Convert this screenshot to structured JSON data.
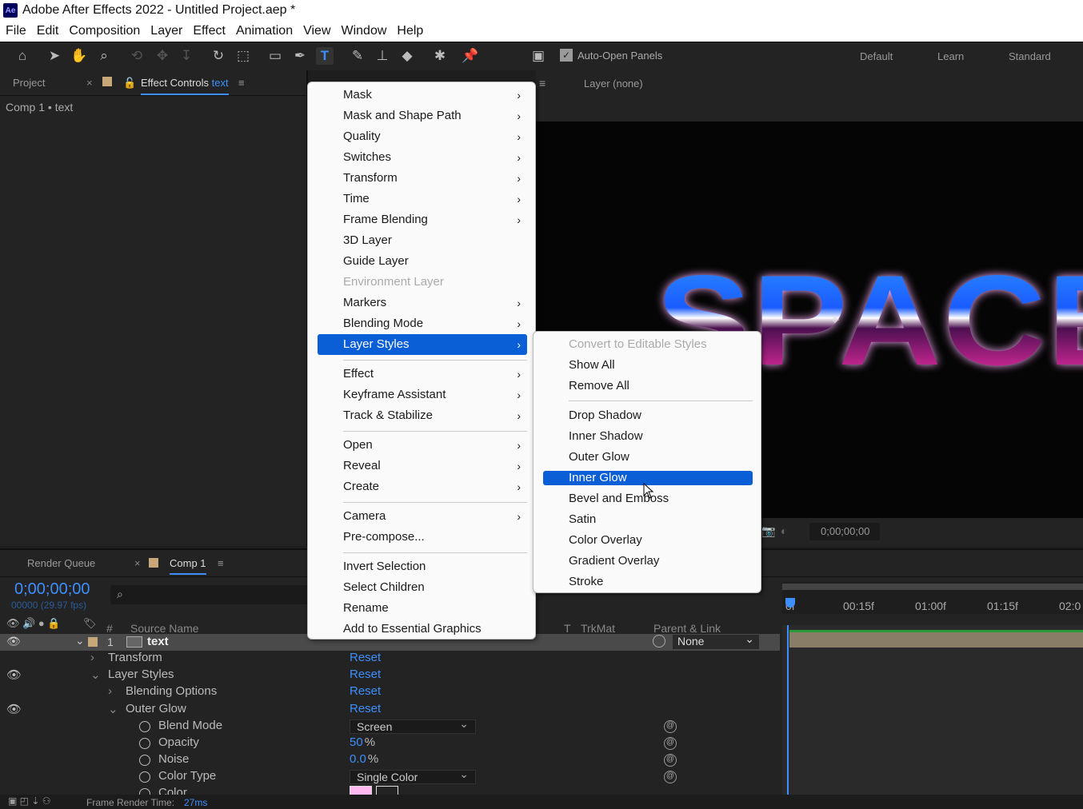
{
  "title": "Adobe After Effects 2022 - Untitled Project.aep *",
  "app_icon": "Ae",
  "menubar": [
    "File",
    "Edit",
    "Composition",
    "Layer",
    "Effect",
    "Animation",
    "View",
    "Window",
    "Help"
  ],
  "toolbar": {
    "auto_open": "Auto-Open Panels",
    "workspaces": [
      "Default",
      "Learn",
      "Standard"
    ]
  },
  "left_panel": {
    "tab_project": "Project",
    "tab_effect": "Effect Controls",
    "tab_effect_target": "text",
    "breadcrumb": "Comp 1 • text"
  },
  "viewer": {
    "layer_tab": "Layer (none)",
    "text": "SPACE",
    "timecode": "0;00;00;00"
  },
  "timeline": {
    "tab_render": "Render Queue",
    "tab_comp": "Comp 1",
    "timecode": "0;00;00;00",
    "fps": "00000 (29.97 fps)",
    "cols": {
      "num": "#",
      "source": "Source Name",
      "t": "T",
      "trkmat": "TrkMat",
      "parent": "Parent & Link"
    },
    "ruler": [
      "0f",
      "00:15f",
      "01:00f",
      "01:15f",
      "02:0"
    ],
    "layer": {
      "num": "1",
      "name": "text",
      "parent": "None"
    },
    "rows": {
      "transform": "Transform",
      "layer_styles": "Layer Styles",
      "blending": "Blending Options",
      "outer_glow": "Outer Glow",
      "blend_mode": "Blend Mode",
      "opacity": "Opacity",
      "noise": "Noise",
      "color_type": "Color Type",
      "color": "Color"
    },
    "reset": "Reset",
    "blend_val": "Screen",
    "opacity_val": "50",
    "noise_val": "0.0",
    "pct": "%",
    "color_type_val": "Single Color"
  },
  "status": {
    "label": "Frame Render Time:",
    "value": "27ms"
  },
  "context_menu": [
    "Mask",
    "Mask and Shape Path",
    "Quality",
    "Switches",
    "Transform",
    "Time",
    "Frame Blending",
    "3D Layer",
    "Guide Layer",
    "Environment Layer",
    "Markers",
    "Blending Mode",
    "Layer Styles",
    "Effect",
    "Keyframe Assistant",
    "Track & Stabilize",
    "Open",
    "Reveal",
    "Create",
    "Camera",
    "Pre-compose...",
    "Invert Selection",
    "Select Children",
    "Rename",
    "Add to Essential Graphics"
  ],
  "submenu": [
    "Convert to Editable Styles",
    "Show All",
    "Remove All",
    "Drop Shadow",
    "Inner Shadow",
    "Outer Glow",
    "Inner Glow",
    "Bevel and Emboss",
    "Satin",
    "Color Overlay",
    "Gradient Overlay",
    "Stroke"
  ],
  "colors": {
    "accent": "#3d8fff",
    "highlight": "#0a5fd6"
  }
}
